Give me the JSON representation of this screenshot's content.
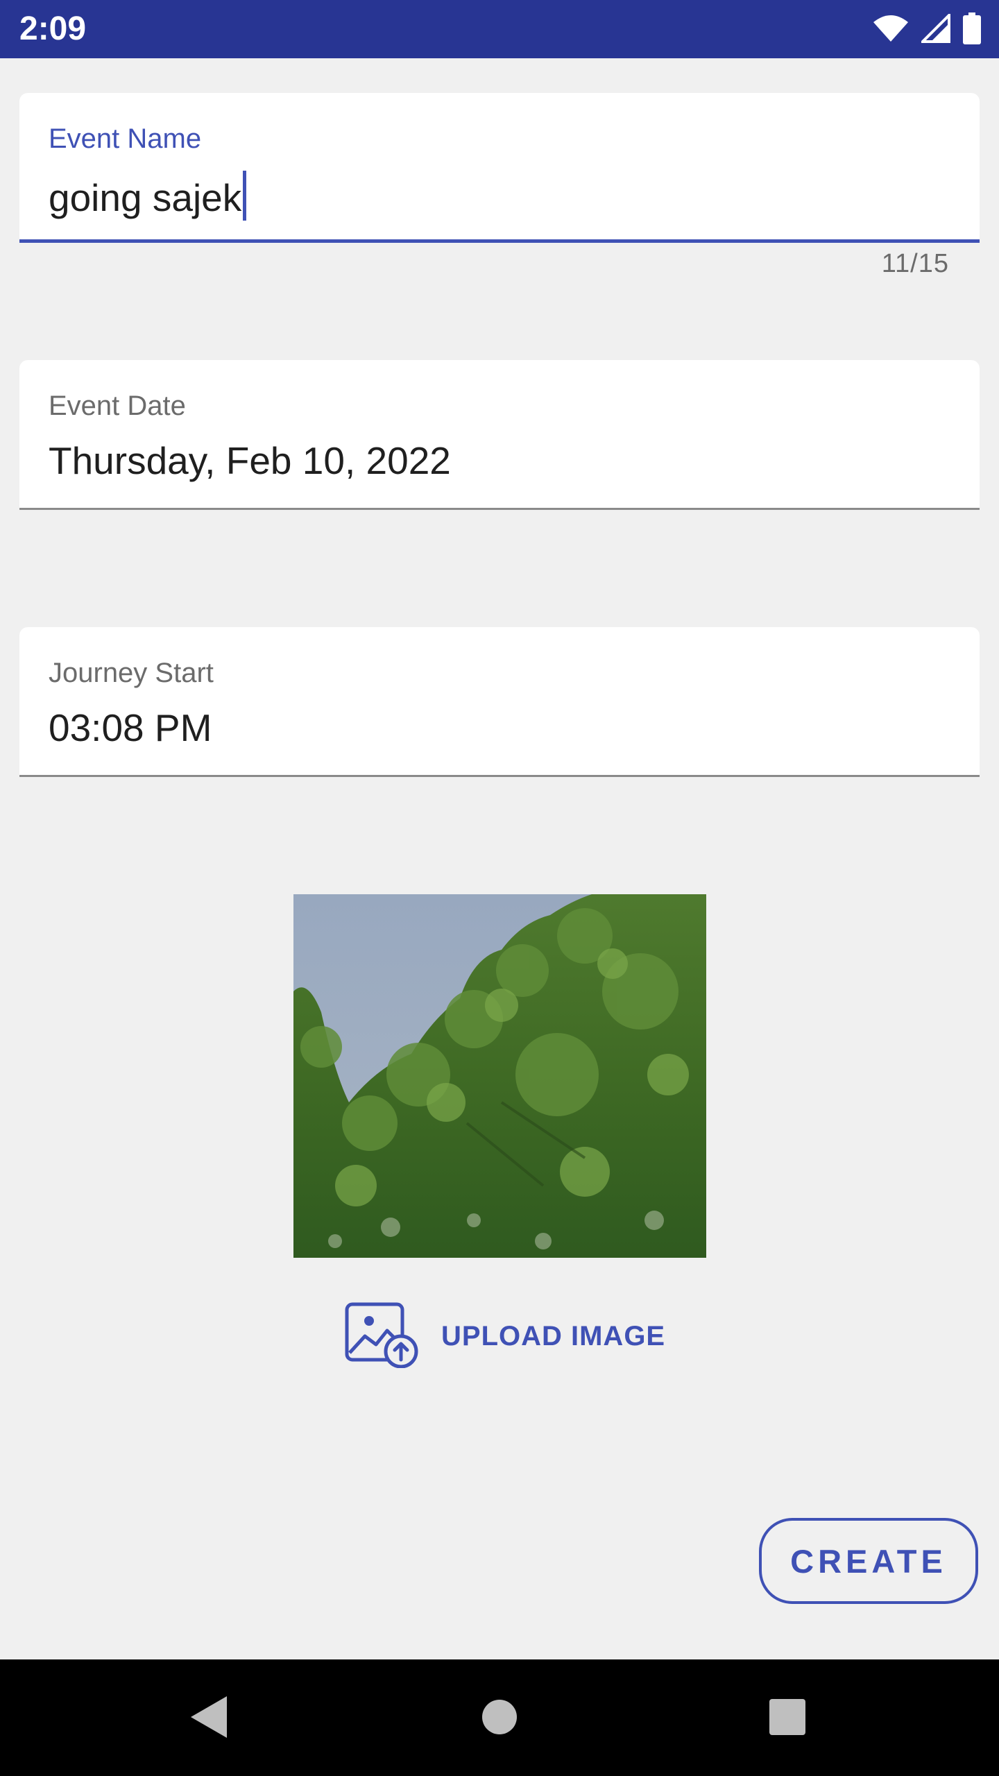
{
  "status_bar": {
    "time": "2:09",
    "icons": [
      "wifi-icon",
      "cell-signal-icon",
      "battery-icon"
    ],
    "background": "#283593"
  },
  "form": {
    "event_name": {
      "label": "Event Name",
      "value": "going sajek",
      "counter": "11/15"
    },
    "event_date": {
      "label": "Event Date",
      "value": "Thursday, Feb 10, 2022"
    },
    "journey_start": {
      "label": "Journey Start",
      "value": "03:08 PM"
    }
  },
  "upload": {
    "label": "UPLOAD IMAGE",
    "icon": "image-upload-icon"
  },
  "actions": {
    "create_label": "CREATE"
  },
  "nav_bar": {
    "icons": [
      "back-icon",
      "home-icon",
      "recents-icon"
    ]
  },
  "colors": {
    "accent": "#3f51b5",
    "background": "#f0f0f0"
  }
}
